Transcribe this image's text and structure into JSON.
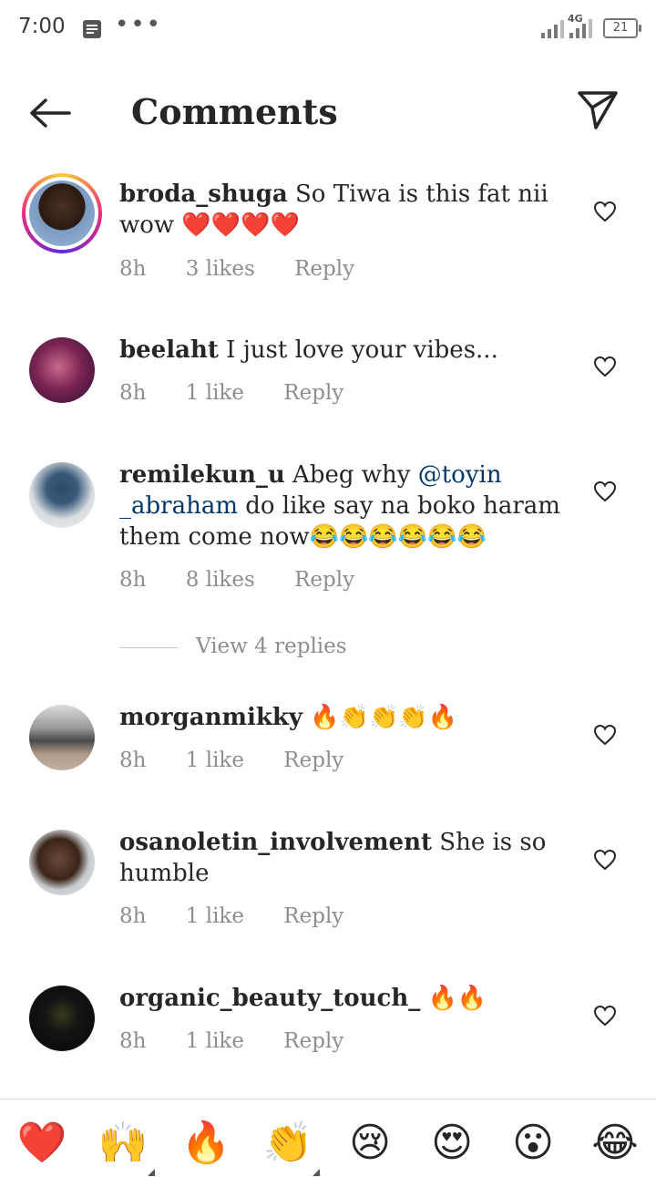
{
  "status_bar": {
    "time": "7:00",
    "network": "4G",
    "battery": "21"
  },
  "header": {
    "title": "Comments"
  },
  "comments": [
    {
      "username": "broda_shuga",
      "text_a": "So Tiwa is this fat nii",
      "text_b": "wow ❤️❤️❤️❤️",
      "time": "8h",
      "likes": "3 likes",
      "reply": "Reply",
      "avatar_color": "#2a1a12"
    },
    {
      "username": "beelaht",
      "text": "I just love your vibes...",
      "time": "8h",
      "likes": "1 like",
      "reply": "Reply",
      "avatar_color": "#7a2454"
    },
    {
      "username": "remilekun_u",
      "text_pre": "Abeg why",
      "mention": "@toyin _abraham",
      "text_post": "do like say na boko haram them come now😂😂😂😂😂😂",
      "time": "8h",
      "likes": "8 likes",
      "reply": "Reply",
      "avatar_color": "#c9d0d6"
    },
    {
      "username": "morganmikky",
      "text": "🔥👏👏👏🔥",
      "time": "8h",
      "likes": "1 like",
      "reply": "Reply",
      "avatar_color": "#8b8580"
    },
    {
      "username": "osanoletin_involvement",
      "text": "She is so humble",
      "time": "8h",
      "likes": "1 like",
      "reply": "Reply",
      "avatar_color": "#5a3a2a"
    },
    {
      "username": "organic_beauty_touch_",
      "text": "🔥🔥",
      "time": "8h",
      "likes": "1 like",
      "reply": "Reply",
      "avatar_color": "#0d0d0d"
    }
  ],
  "view_replies": "View 4 replies",
  "emoji_bar": [
    "❤️",
    "🙌",
    "🔥",
    "👏",
    "😢",
    "😍",
    "😮",
    "😂"
  ]
}
